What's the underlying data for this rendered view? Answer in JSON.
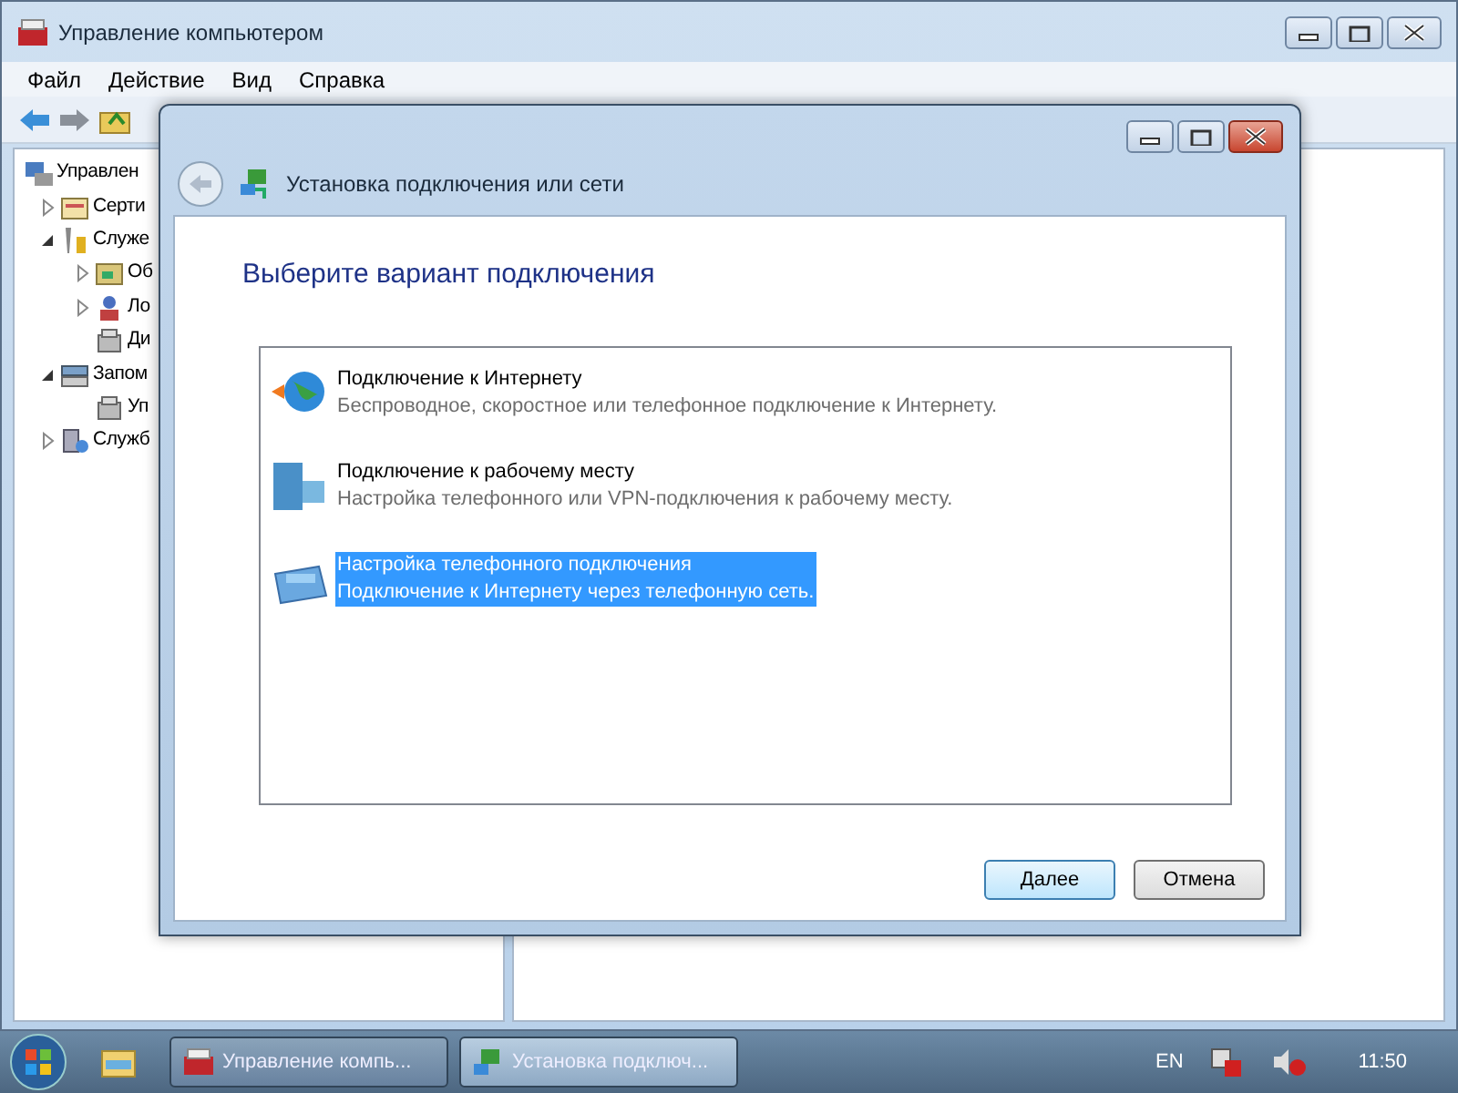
{
  "main_window": {
    "title": "Управление компьютером",
    "menu": [
      "Файл",
      "Действие",
      "Вид",
      "Справка"
    ],
    "tree": [
      {
        "label": "Управлен",
        "kind": "computer",
        "children": [
          {
            "label": "Серти",
            "kind": "tasks",
            "expanded": false
          },
          {
            "label": "Служе",
            "kind": "tools",
            "expanded": true,
            "children": [
              {
                "label": "Об",
                "kind": "viewer",
                "expanded": false
              },
              {
                "label": "Ло",
                "kind": "users",
                "expanded": false
              },
              {
                "label": "Ди",
                "kind": "device"
              }
            ]
          },
          {
            "label": "Запом",
            "kind": "storage",
            "expanded": true,
            "children": [
              {
                "label": "Уп",
                "kind": "device"
              }
            ]
          },
          {
            "label": "Служб",
            "kind": "services",
            "expanded": false
          }
        ]
      }
    ]
  },
  "dialog": {
    "title": "Установка подключения или сети",
    "heading": "Выберите вариант подключения",
    "options": [
      {
        "kind": "internet",
        "title": "Подключение к Интернету",
        "description": "Беспроводное, скоростное или телефонное подключение к Интернету.",
        "selected": false
      },
      {
        "kind": "workplace",
        "title": "Подключение к рабочему месту",
        "description": "Настройка телефонного или VPN-подключения к рабочему месту.",
        "selected": false
      },
      {
        "kind": "dialup",
        "title": "Настройка телефонного подключения",
        "description": "Подключение к Интернету через телефонную сеть.",
        "selected": true
      }
    ],
    "buttons": [
      {
        "label": "Далее",
        "default": true
      },
      {
        "label": "Отмена",
        "default": false
      }
    ]
  },
  "taskbar": {
    "tasks": [
      {
        "kind": "management",
        "label": "Управление компь...",
        "active": false
      },
      {
        "kind": "network",
        "label": "Установка подключ...",
        "active": true
      }
    ],
    "language": "EN",
    "clock": "11:50"
  }
}
